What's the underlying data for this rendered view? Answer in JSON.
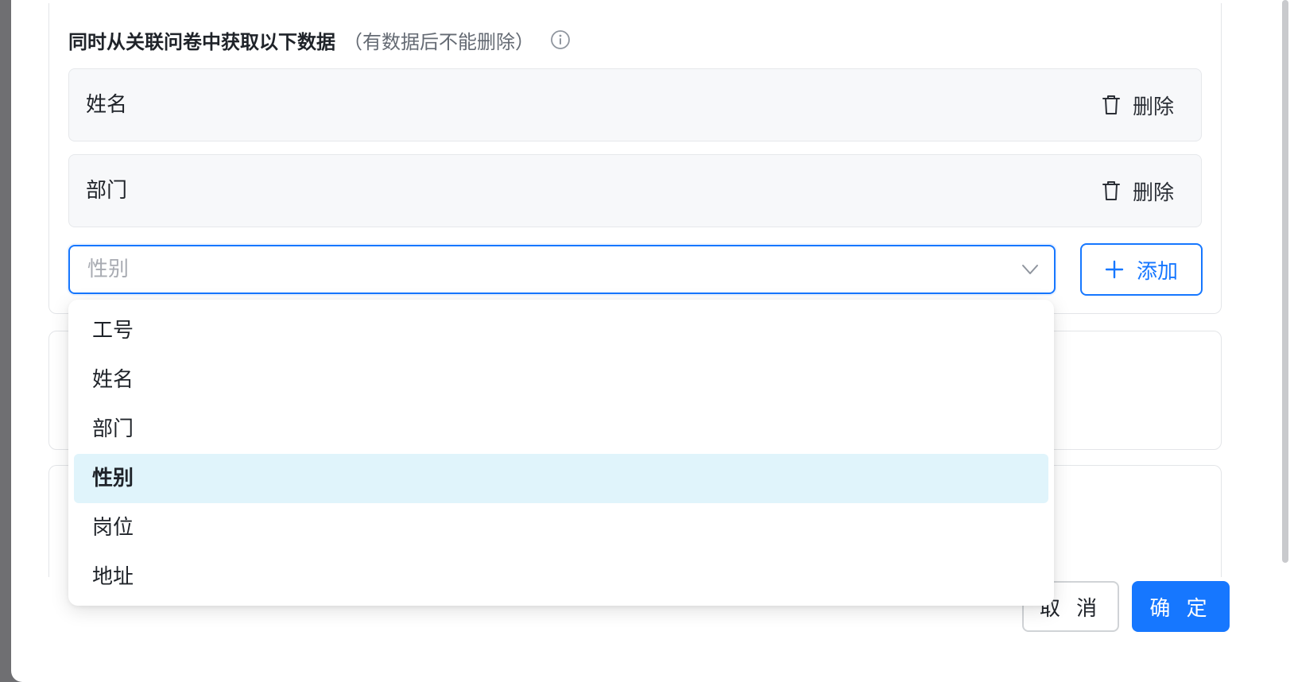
{
  "section": {
    "title": "同时从关联问卷中获取以下数据",
    "hint": "（有数据后不能删除）"
  },
  "fields": [
    {
      "label": "姓名",
      "delete_label": "删除"
    },
    {
      "label": "部门",
      "delete_label": "删除"
    }
  ],
  "select": {
    "placeholder": "性别"
  },
  "add_button": {
    "label": "添加"
  },
  "dropdown": {
    "options": [
      "工号",
      "姓名",
      "部门",
      "性别",
      "岗位",
      "地址"
    ],
    "active": "性别"
  },
  "footer": {
    "cancel_label": "取 消",
    "ok_label": "确 定"
  },
  "colors": {
    "primary": "#1677ff",
    "active_option_bg": "#e0f4fb",
    "row_bg": "#f7f8fa"
  },
  "icons": {
    "info": "info-circle-icon",
    "delete": "trash-icon",
    "add": "plus-icon",
    "select": "chevron-down-icon"
  }
}
